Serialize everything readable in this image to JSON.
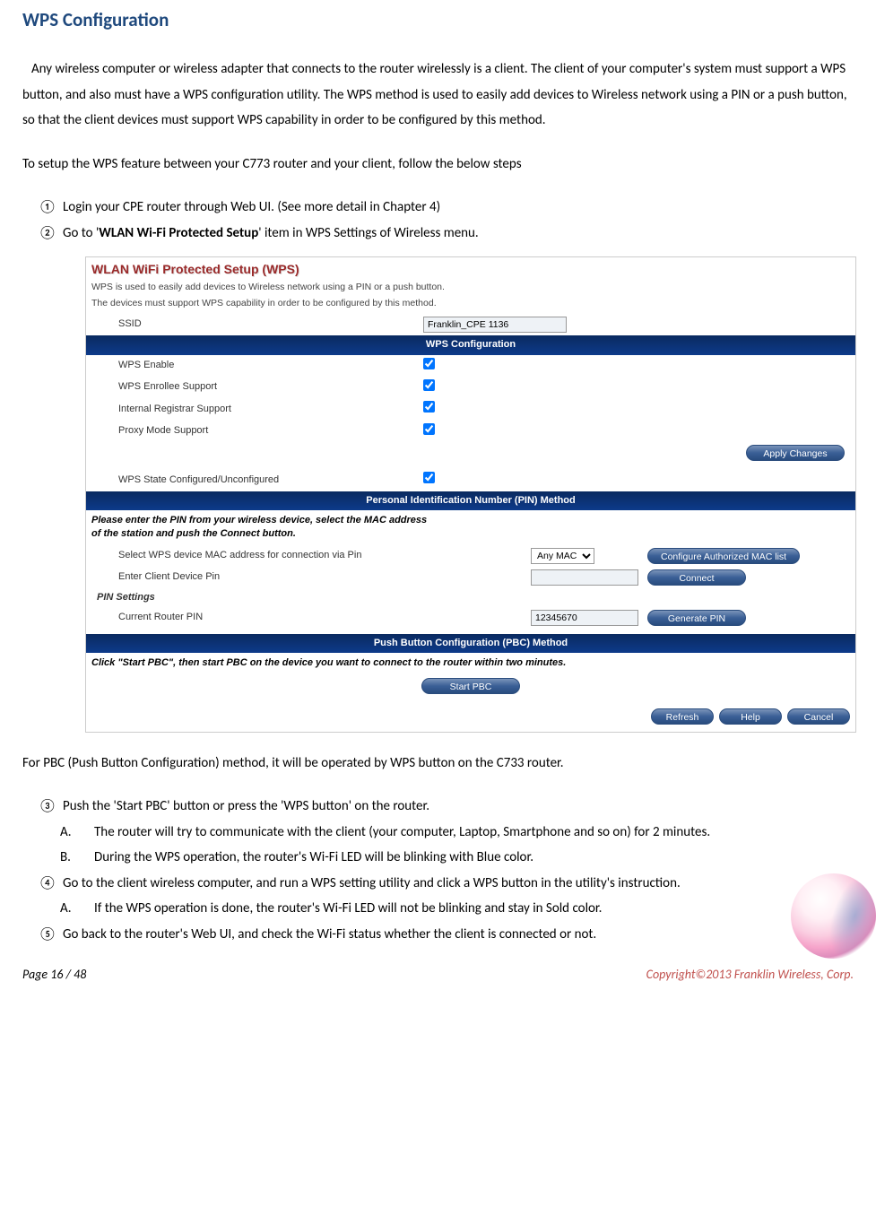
{
  "title": "WPS Configuration",
  "intro": "Any wireless computer or wireless adapter that connects to the router wirelessly is a client. The client of your computer's system must support a WPS button, and also must have a WPS configuration utility. The WPS method is used to easily add devices to Wireless network using a PIN or a push button, so that the client devices must support WPS capability in order to be configured by this method.",
  "setup_line": "To setup the WPS feature between your C773 router and your client, follow the below steps",
  "steps": {
    "m1": "①",
    "t1": "Login your CPE router through Web UI. (See more detail in Chapter 4)",
    "m2": "②",
    "t2a": "Go to '",
    "t2b": "WLAN Wi-Fi Protected Setup",
    "t2c": "' item in WPS Settings of Wireless menu."
  },
  "ui": {
    "heading": "WLAN WiFi Protected Setup (WPS)",
    "desc1": "WPS is used to easily add devices to Wireless network using a PIN or a push button.",
    "desc2": "The devices must support WPS capability in order to be configured by this method.",
    "ssid_label": "SSID",
    "ssid_value": "Franklin_CPE 1136",
    "bar_wps": "WPS Configuration",
    "wps_enable": "WPS Enable",
    "enrollee": "WPS Enrollee Support",
    "registrar": "Internal Registrar Support",
    "proxy": "Proxy Mode Support",
    "apply": "Apply Changes",
    "state": "WPS State Configured/Unconfigured",
    "bar_pin": "Personal Identification Number (PIN) Method",
    "pin_instr1": "Please enter the PIN from your wireless device, select the MAC address",
    "pin_instr2": "of the station and push the Connect button.",
    "select_mac": "Select WPS device MAC address for connection via Pin",
    "any_mac": "Any MAC",
    "btn_cfg_mac": "Configure Authorized MAC list",
    "enter_pin": "Enter Client Device Pin",
    "btn_connect": "Connect",
    "pin_settings": "PIN Settings",
    "current_pin": "Current Router PIN",
    "current_pin_val": "12345670",
    "btn_genpin": "Generate PIN",
    "bar_pbc": "Push Button Configuration (PBC) Method",
    "pbc_instr": "Click \"Start PBC\", then start PBC on the device you want to connect to the router within two minutes.",
    "btn_startpbc": "Start PBC",
    "btn_refresh": "Refresh",
    "btn_help": "Help",
    "btn_cancel": "Cancel"
  },
  "pbc_intro": "For PBC (Push Button Configuration) method, it will be operated by WPS button on the C733 router.",
  "s3": {
    "m": "③",
    "t": "Push the 'Start PBC' button or press the 'WPS button' on the router."
  },
  "s3a": {
    "m": "A.",
    "t": "The router will try to communicate with the client (your computer, Laptop, Smartphone and so on) for 2 minutes."
  },
  "s3b": {
    "m": "B.",
    "t": "During the WPS operation, the router's Wi-Fi LED will be blinking with Blue color."
  },
  "s4": {
    "m": "④",
    "t": "Go to the client wireless computer, and run a WPS setting utility and click a WPS button in the utility's instruction."
  },
  "s4a": {
    "m": "A.",
    "t": "If the WPS operation is done, the router's Wi-Fi LED will not be blinking and stay in Sold color."
  },
  "s5": {
    "m": "⑤",
    "t": "Go back to the router's Web UI, and check the Wi-Fi status whether the client is connected or not."
  },
  "footer": {
    "page": "Page  16  /  48",
    "copyright": "Copyright©2013  Franklin  Wireless, Corp."
  }
}
